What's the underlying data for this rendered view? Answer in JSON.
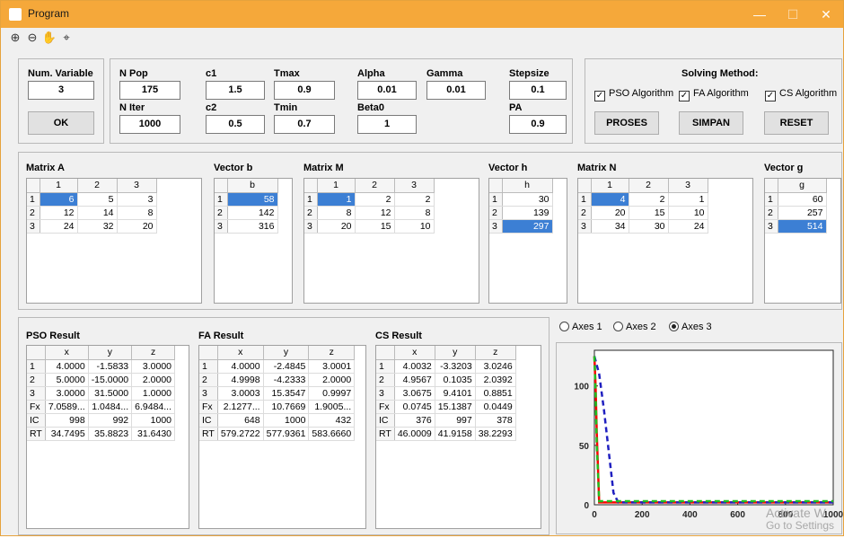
{
  "window": {
    "title": "Program"
  },
  "params": {
    "num_variable": {
      "label": "Num. Variable",
      "value": "3"
    },
    "npop": {
      "label": "N Pop",
      "value": "175"
    },
    "niter": {
      "label": "N Iter",
      "value": "1000"
    },
    "c1": {
      "label": "c1",
      "value": "1.5"
    },
    "c2": {
      "label": "c2",
      "value": "0.5"
    },
    "tmax": {
      "label": "Tmax",
      "value": "0.9"
    },
    "tmin": {
      "label": "Tmin",
      "value": "0.7"
    },
    "alpha": {
      "label": "Alpha",
      "value": "0.01"
    },
    "beta0": {
      "label": "Beta0",
      "value": "1"
    },
    "gamma": {
      "label": "Gamma",
      "value": "0.01"
    },
    "stepsize": {
      "label": "Stepsize",
      "value": "0.1"
    },
    "pa": {
      "label": "PA",
      "value": "0.9"
    },
    "ok_label": "OK"
  },
  "solving": {
    "title": "Solving Method:",
    "pso": "PSO Algorithm",
    "fa": "FA Algorithm",
    "cs": "CS Algorithm",
    "proses": "PROSES",
    "simpan": "SIMPAN",
    "reset": "RESET",
    "check_mark": "✓"
  },
  "matrices": {
    "a": {
      "title": "Matrix A",
      "cols": [
        "1",
        "2",
        "3"
      ],
      "rows": [
        [
          "1",
          "6",
          "5",
          "3"
        ],
        [
          "2",
          "12",
          "14",
          "8"
        ],
        [
          "3",
          "24",
          "32",
          "20"
        ]
      ]
    },
    "b": {
      "title": "Vector b",
      "cols": [
        "b"
      ],
      "rows": [
        [
          "1",
          "58"
        ],
        [
          "2",
          "142"
        ],
        [
          "3",
          "316"
        ]
      ]
    },
    "m": {
      "title": "Matrix M",
      "cols": [
        "1",
        "2",
        "3"
      ],
      "rows": [
        [
          "1",
          "1",
          "2",
          "2"
        ],
        [
          "2",
          "8",
          "12",
          "8"
        ],
        [
          "3",
          "20",
          "15",
          "10"
        ]
      ]
    },
    "h": {
      "title": "Vector h",
      "cols": [
        "h"
      ],
      "rows": [
        [
          "1",
          "30"
        ],
        [
          "2",
          "139"
        ],
        [
          "3",
          "297"
        ]
      ]
    },
    "n": {
      "title": "Matrix N",
      "cols": [
        "1",
        "2",
        "3"
      ],
      "rows": [
        [
          "1",
          "4",
          "2",
          "1"
        ],
        [
          "2",
          "20",
          "15",
          "10"
        ],
        [
          "3",
          "34",
          "30",
          "24"
        ]
      ]
    },
    "g": {
      "title": "Vector g",
      "cols": [
        "g"
      ],
      "rows": [
        [
          "1",
          "60"
        ],
        [
          "2",
          "257"
        ],
        [
          "3",
          "514"
        ]
      ]
    }
  },
  "results": {
    "pso": {
      "title": "PSO Result",
      "cols": [
        "x",
        "y",
        "z"
      ],
      "rows": [
        [
          "1",
          "4.0000",
          "-1.5833",
          "3.0000"
        ],
        [
          "2",
          "5.0000",
          "-15.0000",
          "2.0000"
        ],
        [
          "3",
          "3.0000",
          "31.5000",
          "1.0000"
        ],
        [
          "Fx",
          "7.0589...",
          "1.0484...",
          "6.9484..."
        ],
        [
          "IC",
          "998",
          "992",
          "1000"
        ],
        [
          "RT",
          "34.7495",
          "35.8823",
          "31.6430"
        ]
      ]
    },
    "fa": {
      "title": "FA Result",
      "cols": [
        "x",
        "y",
        "z"
      ],
      "rows": [
        [
          "1",
          "4.0000",
          "-2.4845",
          "3.0001"
        ],
        [
          "2",
          "4.9998",
          "-4.2333",
          "2.0000"
        ],
        [
          "3",
          "3.0003",
          "15.3547",
          "0.9997"
        ],
        [
          "Fx",
          "2.1277...",
          "10.7669",
          "1.9005..."
        ],
        [
          "IC",
          "648",
          "1000",
          "432"
        ],
        [
          "RT",
          "579.2722",
          "577.9361",
          "583.6660"
        ]
      ]
    },
    "cs": {
      "title": "CS Result",
      "cols": [
        "x",
        "y",
        "z"
      ],
      "rows": [
        [
          "1",
          "4.0032",
          "-3.3203",
          "3.0246"
        ],
        [
          "2",
          "4.9567",
          "0.1035",
          "2.0392"
        ],
        [
          "3",
          "3.0675",
          "9.4101",
          "0.8851"
        ],
        [
          "Fx",
          "0.0745",
          "15.1387",
          "0.0449"
        ],
        [
          "IC",
          "376",
          "997",
          "378"
        ],
        [
          "RT",
          "46.0009",
          "41.9158",
          "38.2293"
        ]
      ]
    }
  },
  "axes_select": {
    "a1": "Axes 1",
    "a2": "Axes 2",
    "a3": "Axes 3",
    "selected": "Axes 3"
  },
  "watermark": {
    "line1": "Activate W",
    "line2": "Go to Settings"
  },
  "chart_data": {
    "type": "line",
    "xlim": [
      0,
      1000
    ],
    "ylim": [
      0,
      130
    ],
    "xticks": [
      "0",
      "200",
      "400",
      "600",
      "800",
      "1000"
    ],
    "yticks": [
      "0",
      "50",
      "100"
    ],
    "series": [
      {
        "color": "#ff0000",
        "style": "solid",
        "x": [
          0,
          5,
          10,
          20,
          1000
        ],
        "y": [
          125,
          100,
          60,
          2,
          2
        ]
      },
      {
        "color": "#2020c0",
        "style": "dashed",
        "x": [
          0,
          20,
          40,
          60,
          80,
          100,
          1000
        ],
        "y": [
          125,
          110,
          80,
          45,
          10,
          2,
          2
        ]
      },
      {
        "color": "#20c020",
        "style": "dashed",
        "x": [
          0,
          5,
          10,
          20,
          1000
        ],
        "y": [
          125,
          95,
          50,
          3,
          3
        ]
      }
    ]
  }
}
